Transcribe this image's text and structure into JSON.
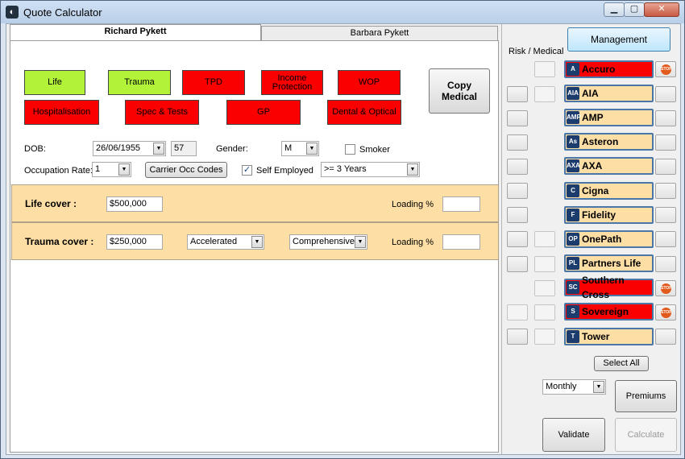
{
  "window": {
    "title": "Quote Calculator",
    "min": "0",
    "max": "1",
    "close": "r"
  },
  "tabs": [
    "Richard Pykett",
    "Barbara Pykett"
  ],
  "cover_buttons": [
    {
      "label": "Life",
      "color": "#b2f33a"
    },
    {
      "label": "Trauma",
      "color": "#b2f33a"
    },
    {
      "label": "TPD",
      "color": "#fb0000"
    },
    {
      "label": "Income Protection",
      "color": "#fb0000"
    },
    {
      "label": "WOP",
      "color": "#fb0000"
    },
    {
      "label": "Hospitalisation",
      "color": "#fb0000"
    },
    {
      "label": "Spec & Tests",
      "color": "#fb0000"
    },
    {
      "label": "GP",
      "color": "#fb0000"
    },
    {
      "label": "Dental & Optical",
      "color": "#fb0000"
    }
  ],
  "copy_medical": "Copy Medical",
  "person": {
    "dob_label": "DOB:",
    "dob": "26/06/1955",
    "age": "57",
    "gender_label": "Gender:",
    "gender": "M",
    "smoker_label": "Smoker",
    "occupation_label": "Occupation Rate:",
    "occupation_rate": "1",
    "carrier_occ_codes": "Carrier Occ Codes",
    "self_employed_label": "Self Employed",
    "self_employed_checked": "✓",
    "years": ">= 3 Years"
  },
  "life_cover": {
    "label": "Life cover :",
    "amount": "$500,000",
    "loading_label": "Loading %",
    "loading": ""
  },
  "trauma_cover": {
    "label": "Trauma cover :",
    "amount": "$250,000",
    "type": "Accelerated",
    "level": "Comprehensive",
    "loading_label": "Loading %",
    "loading": ""
  },
  "right": {
    "management": "Management",
    "risk_medical_label": "Risk / Medical",
    "carriers": [
      {
        "name": "Accuro",
        "status": "error",
        "logo": "A"
      },
      {
        "name": "AIA",
        "status": "ok",
        "logo": "AIA"
      },
      {
        "name": "AMP",
        "status": "ok",
        "logo": "AMP"
      },
      {
        "name": "Asteron",
        "status": "ok",
        "logo": "As"
      },
      {
        "name": "AXA",
        "status": "ok",
        "logo": "AXA"
      },
      {
        "name": "Cigna",
        "status": "ok",
        "logo": "C"
      },
      {
        "name": "Fidelity",
        "status": "ok",
        "logo": "F"
      },
      {
        "name": "OnePath",
        "status": "ok",
        "logo": "OP"
      },
      {
        "name": "Partners Life",
        "status": "ok",
        "logo": "PL"
      },
      {
        "name": "Southern Cross",
        "status": "error",
        "logo": "SC"
      },
      {
        "name": "Sovereign",
        "status": "error",
        "logo": "S"
      },
      {
        "name": "Tower",
        "status": "ok",
        "logo": "T"
      }
    ],
    "stop_text": "STOP",
    "select_all": "Select All",
    "frequency": "Monthly",
    "premiums": "Premiums",
    "validate": "Validate",
    "calculate": "Calculate"
  },
  "colors": {
    "ok": "#fddfa6",
    "error": "#fb0000",
    "green": "#b2f33a"
  }
}
